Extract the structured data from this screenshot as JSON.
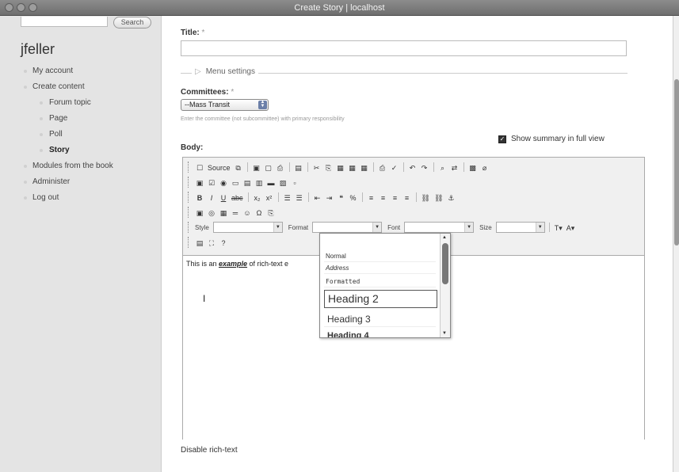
{
  "window": {
    "title": "Create Story | localhost"
  },
  "sidebar": {
    "search_button": "Search",
    "username": "jfeller",
    "items": [
      {
        "label": "My account"
      },
      {
        "label": "Create content"
      },
      {
        "label": "Forum topic"
      },
      {
        "label": "Page"
      },
      {
        "label": "Poll"
      },
      {
        "label": "Story"
      },
      {
        "label": "Modules from the book"
      },
      {
        "label": "Administer"
      },
      {
        "label": "Log out"
      }
    ]
  },
  "form": {
    "title_label": "Title:",
    "required_mark": "*",
    "title_value": "",
    "menu_settings": "Menu settings",
    "committees_label": "Committees:",
    "committees_value": "--Mass Transit",
    "committees_help": "Enter the committee (not subcommittee) with primary responsibility",
    "show_summary": "Show summary in full view",
    "show_summary_checked": true,
    "body_label": "Body:",
    "disable_rich_text": "Disable rich-text"
  },
  "editor": {
    "source_label": "Source",
    "style_label": "Style",
    "format_label": "Format",
    "font_label": "Font",
    "size_label": "Size",
    "content_before": "This is an ",
    "content_emph": "example",
    "content_after": " of rich-text e",
    "format_options": [
      "Normal",
      "Address",
      "Formatted",
      "Heading 2",
      "Heading 3",
      "Heading 4"
    ],
    "format_highlighted": "Heading 2"
  }
}
